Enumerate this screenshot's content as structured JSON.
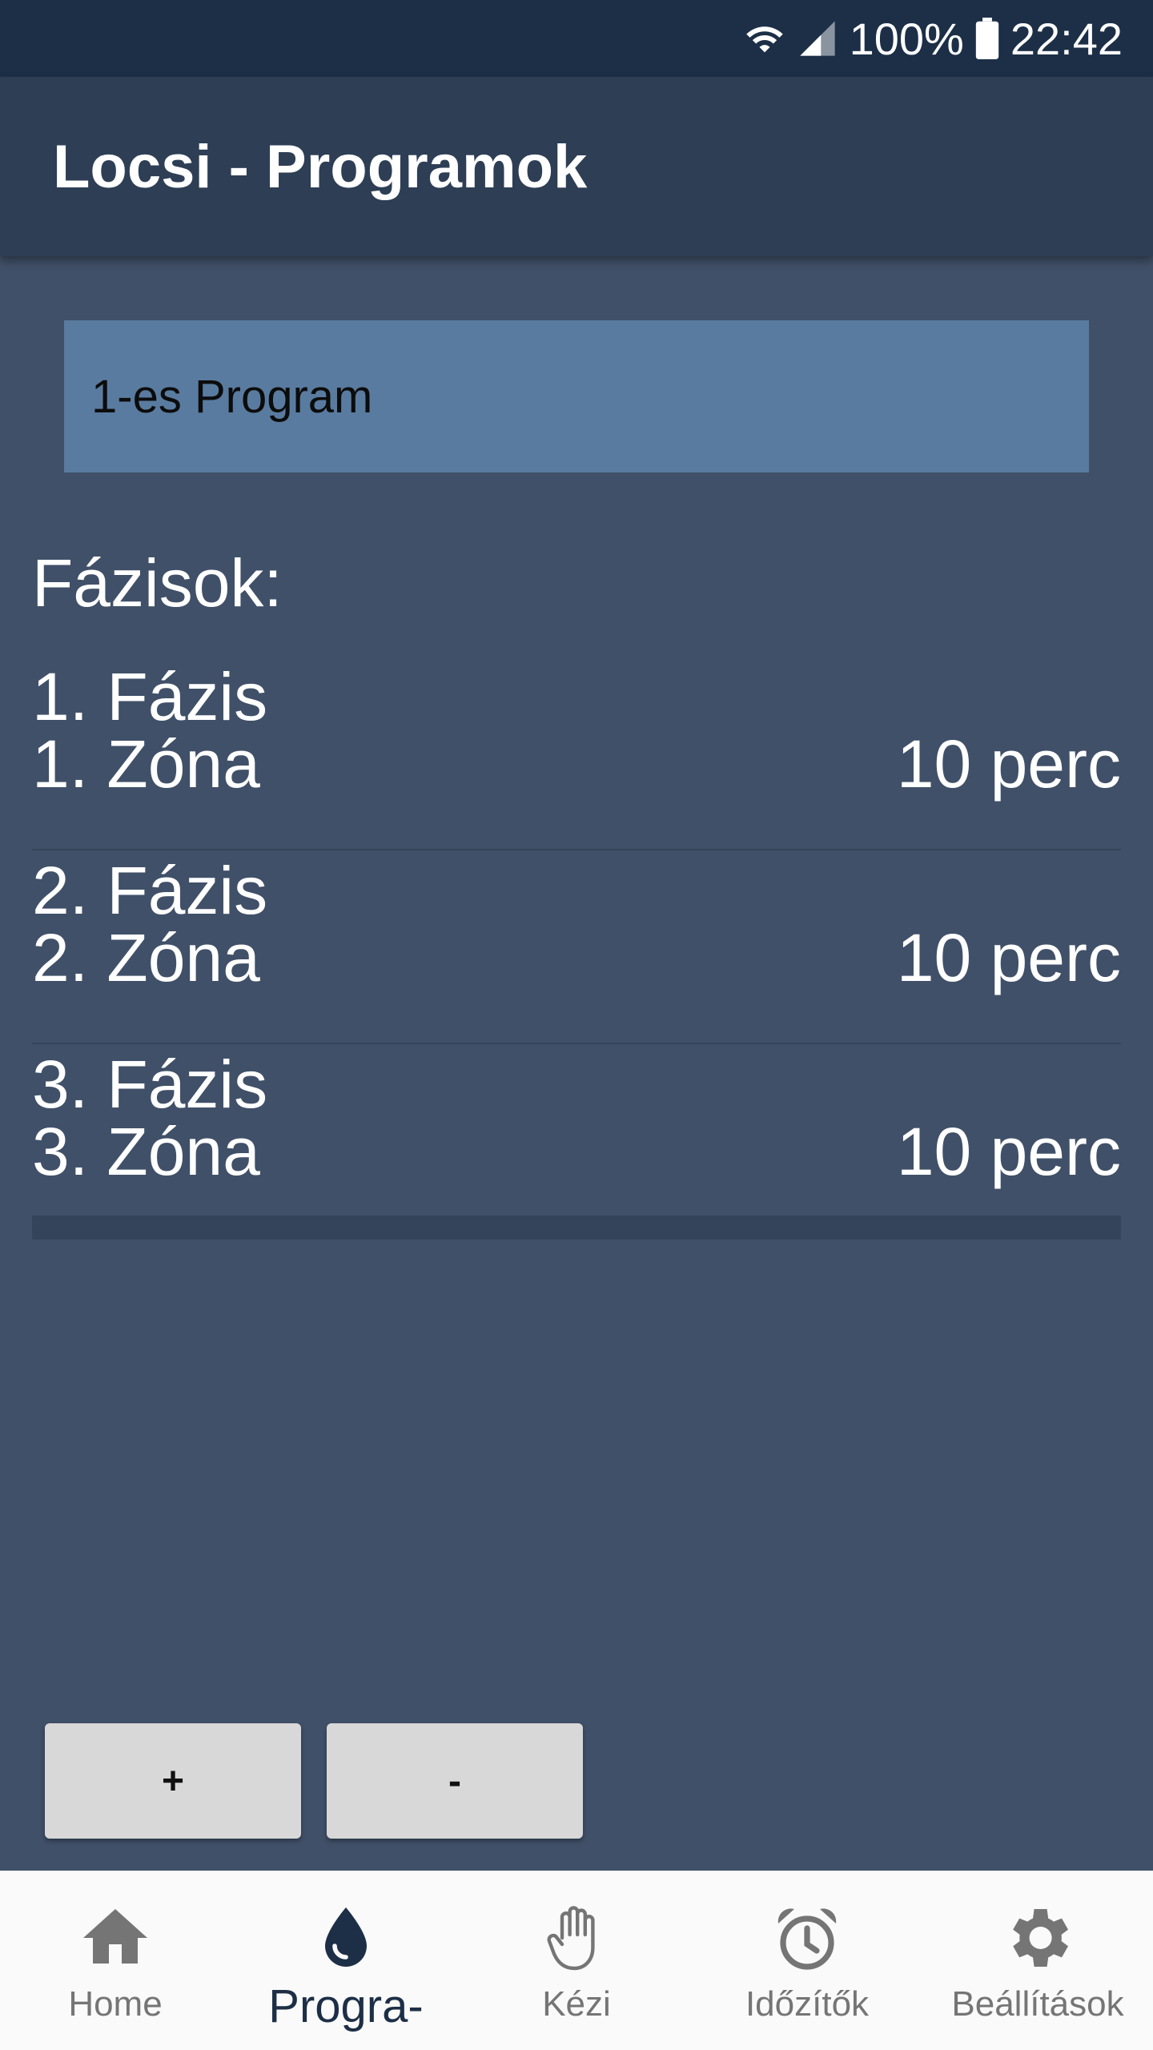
{
  "status_bar": {
    "battery_text": "100%",
    "time": "22:42",
    "icons": [
      "wifi-icon",
      "signal-icon",
      "battery-icon"
    ]
  },
  "app_bar": {
    "title": "Locsi - Programok"
  },
  "program_selector": {
    "value": "1-es Program"
  },
  "phases": {
    "label": "Fázisok:",
    "items": [
      {
        "title": "1. Fázis",
        "zone": "1. Zóna",
        "duration": "10 perc"
      },
      {
        "title": "2. Fázis",
        "zone": "2. Zóna",
        "duration": "10 perc"
      },
      {
        "title": "3. Fázis",
        "zone": "3. Zóna",
        "duration": "10 perc"
      }
    ]
  },
  "buttons": {
    "add": "+",
    "remove": "-"
  },
  "bottom_nav": {
    "items": [
      {
        "label": "Home",
        "icon": "home-icon",
        "active": false
      },
      {
        "label": "Progra-",
        "icon": "water-drop-icon",
        "active": true
      },
      {
        "label": "Kézi",
        "icon": "hand-icon",
        "active": false
      },
      {
        "label": "Időzítők",
        "icon": "alarm-clock-icon",
        "active": false
      },
      {
        "label": "Beállítások",
        "icon": "gear-icon",
        "active": false
      }
    ]
  },
  "colors": {
    "background": "#405068",
    "status_bar": "#1c2f47",
    "app_bar": "#2d3e55",
    "program_box": "#597b9f",
    "button": "#d8d8d8",
    "nav_active": "#1d2f46",
    "nav_inactive": "#757575"
  }
}
